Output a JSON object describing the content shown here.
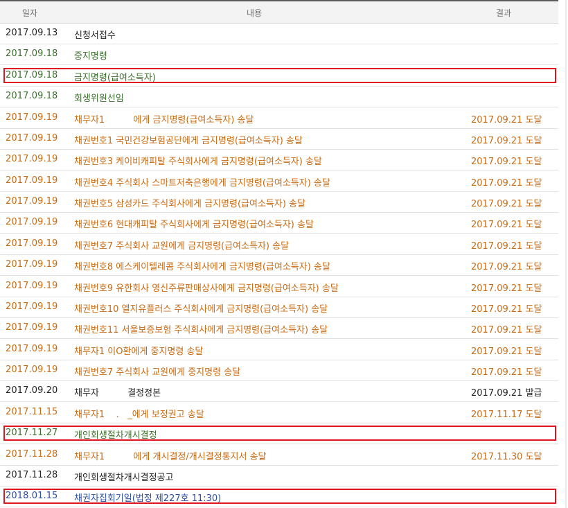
{
  "header": {
    "date": "일자",
    "content": "내용",
    "result": "결과"
  },
  "rows": [
    {
      "date": "2017.09.13",
      "content": "신청서접수",
      "result": "",
      "color": "black"
    },
    {
      "date": "2017.09.18",
      "content": "중지명령",
      "result": "",
      "color": "green"
    },
    {
      "date": "2017.09.18",
      "content": "금지명령(급여소득자)",
      "result": "",
      "color": "green",
      "highlighted": true
    },
    {
      "date": "2017.09.18",
      "content": "회생위원선임",
      "result": "",
      "color": "green"
    },
    {
      "date": "2017.09.19",
      "content": "채무자1          에게 금지명령(급여소득자) 송달",
      "result": "2017.09.21 도달",
      "color": "orange"
    },
    {
      "date": "2017.09.19",
      "content": "채권번호1 국민건강보험공단에게 금지명령(급여소득자) 송달",
      "result": "2017.09.21 도달",
      "color": "orange"
    },
    {
      "date": "2017.09.19",
      "content": "채권번호3 케이비캐피탈 주식회사에게 금지명령(급여소득자) 송달",
      "result": "2017.09.21 도달",
      "color": "orange"
    },
    {
      "date": "2017.09.19",
      "content": "채권번호4 주식회사 스마트저축은행에게 금지명령(급여소득자) 송달",
      "result": "2017.09.21 도달",
      "color": "orange"
    },
    {
      "date": "2017.09.19",
      "content": "채권번호5 삼성카드 주식회사에게 금지명령(급여소득자) 송달",
      "result": "2017.09.21 도달",
      "color": "orange"
    },
    {
      "date": "2017.09.19",
      "content": "채권번호6 현대캐피탈 주식회사에게 금지명령(급여소득자) 송달",
      "result": "2017.09.21 도달",
      "color": "orange"
    },
    {
      "date": "2017.09.19",
      "content": "채권번호7 주식회사 교원에게 금지명령(급여소득자) 송달",
      "result": "2017.09.21 도달",
      "color": "orange"
    },
    {
      "date": "2017.09.19",
      "content": "채권번호8 에스케이텔레콤 주식회사에게 금지명령(급여소득자) 송달",
      "result": "2017.09.21 도달",
      "color": "orange"
    },
    {
      "date": "2017.09.19",
      "content": "채권번호9 유한회사 영신주류판매상사에게 금지명령(급여소득자) 송달",
      "result": "2017.09.21 도달",
      "color": "orange"
    },
    {
      "date": "2017.09.19",
      "content": "채권번호10 엘지유플러스 주식회사에게 금지명령(급여소득자) 송달",
      "result": "2017.09.21 도달",
      "color": "orange"
    },
    {
      "date": "2017.09.19",
      "content": "채권번호11 서울보증보험 주식회사에게 금지명령(급여소득자) 송달",
      "result": "2017.09.21 도달",
      "color": "orange"
    },
    {
      "date": "2017.09.19",
      "content": "채무자1 이O환에게 중지명령 송달",
      "result": "2017.09.21 도달",
      "color": "orange"
    },
    {
      "date": "2017.09.19",
      "content": "채권번호7 주식회사 교원에게 중지명령 송달",
      "result": "2017.09.21 도달",
      "color": "orange"
    },
    {
      "date": "2017.09.20",
      "content": "채무자          결정정본",
      "result": "2017.09.21 발급",
      "color": "black"
    },
    {
      "date": "2017.11.15",
      "content": "채무자1    .   _에게 보정권고 송달",
      "result": "2017.11.17 도달",
      "color": "orange"
    },
    {
      "date": "2017.11.27",
      "content": "개인회생절차개시결정",
      "result": "",
      "color": "green",
      "highlighted": true
    },
    {
      "date": "2017.11.28",
      "content": "채무자1          에게 개시결정/개시결정통지서 송달",
      "result": "2017.11.30 도달",
      "color": "orange"
    },
    {
      "date": "2017.11.28",
      "content": "개인회생절차개시결정공고",
      "result": "",
      "color": "black"
    },
    {
      "date": "2018.01.15",
      "content": "채권자집회기일(법정 제227호 11:30)",
      "result": "",
      "color": "blue",
      "highlighted": true
    }
  ],
  "colors": {
    "black": "#222222",
    "green": "#3a6e2c",
    "orange": "#c96a12",
    "blue": "#2a4fa5",
    "highlight_border": "#e0141e"
  }
}
